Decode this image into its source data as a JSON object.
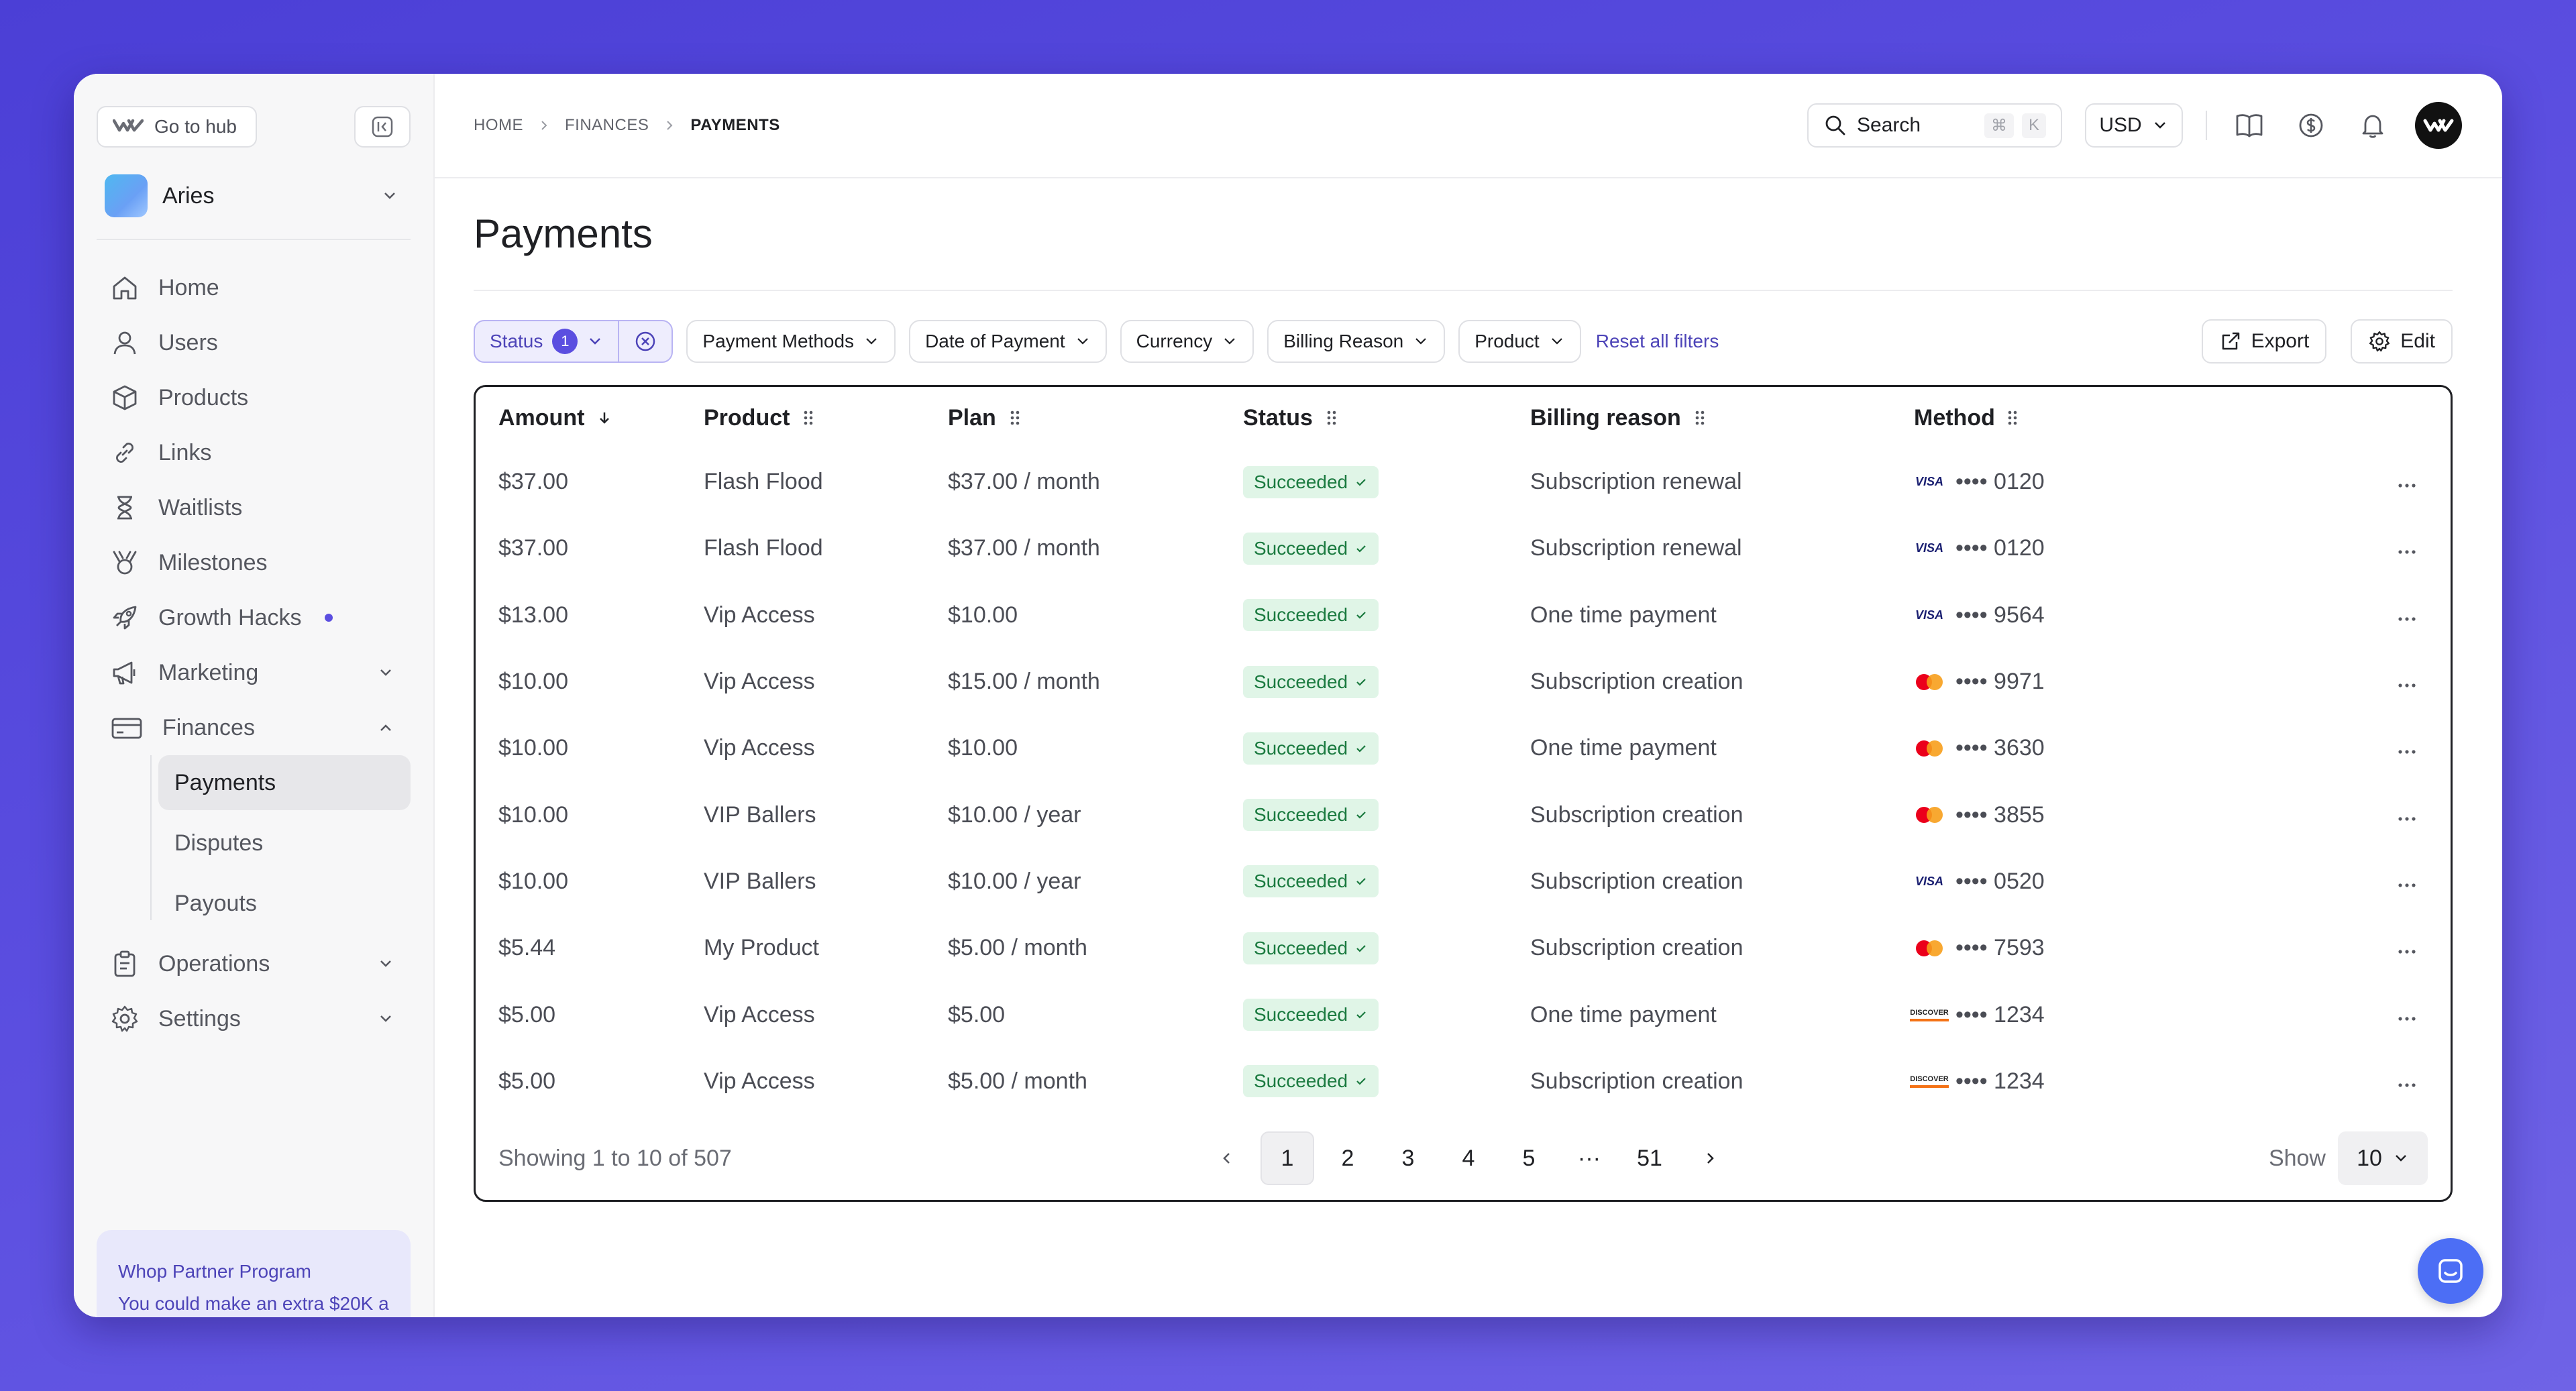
{
  "sidebar": {
    "hub_label": "Go to hub",
    "workspace": "Aries",
    "nav": [
      {
        "label": "Home",
        "icon": "home-icon"
      },
      {
        "label": "Users",
        "icon": "user-icon"
      },
      {
        "label": "Products",
        "icon": "box-icon"
      },
      {
        "label": "Links",
        "icon": "link-icon"
      },
      {
        "label": "Waitlists",
        "icon": "hourglass-icon"
      },
      {
        "label": "Milestones",
        "icon": "trophy-icon"
      },
      {
        "label": "Growth Hacks",
        "icon": "rocket-icon"
      },
      {
        "label": "Marketing",
        "icon": "megaphone-icon"
      },
      {
        "label": "Finances",
        "icon": "card-icon"
      }
    ],
    "finances_sub": [
      "Payments",
      "Disputes",
      "Payouts"
    ],
    "nav_bottom": [
      {
        "label": "Operations",
        "icon": "clipboard-icon"
      },
      {
        "label": "Settings",
        "icon": "gear-icon"
      }
    ],
    "partner": {
      "title": "Whop Partner Program",
      "text": "You could make an extra $20K a"
    }
  },
  "breadcrumb": [
    "HOME",
    "FINANCES",
    "PAYMENTS"
  ],
  "topbar": {
    "search_label": "Search",
    "kbd": [
      "⌘",
      "K"
    ],
    "currency": "USD"
  },
  "page": {
    "title": "Payments"
  },
  "filters": {
    "status_label": "Status",
    "status_count": "1",
    "chips": [
      "Payment Methods",
      "Date of Payment",
      "Currency",
      "Billing Reason",
      "Product"
    ],
    "reset": "Reset all filters",
    "export": "Export",
    "edit": "Edit"
  },
  "table": {
    "headers": [
      "Amount",
      "Product",
      "Plan",
      "Status",
      "Billing reason",
      "Method"
    ],
    "rows": [
      {
        "amount": "$37.00",
        "product": "Flash Flood",
        "plan": "$37.00 / month",
        "status": "Succeeded",
        "reason": "Subscription renewal",
        "brand": "visa",
        "last4": "•••• 0120"
      },
      {
        "amount": "$37.00",
        "product": "Flash Flood",
        "plan": "$37.00 / month",
        "status": "Succeeded",
        "reason": "Subscription renewal",
        "brand": "visa",
        "last4": "•••• 0120"
      },
      {
        "amount": "$13.00",
        "product": "Vip Access",
        "plan": "$10.00",
        "status": "Succeeded",
        "reason": "One time payment",
        "brand": "visa",
        "last4": "•••• 9564"
      },
      {
        "amount": "$10.00",
        "product": "Vip Access",
        "plan": "$15.00 / month",
        "status": "Succeeded",
        "reason": "Subscription creation",
        "brand": "mastercard",
        "last4": "•••• 9971"
      },
      {
        "amount": "$10.00",
        "product": "Vip Access",
        "plan": "$10.00",
        "status": "Succeeded",
        "reason": "One time payment",
        "brand": "mastercard",
        "last4": "•••• 3630"
      },
      {
        "amount": "$10.00",
        "product": "VIP Ballers",
        "plan": "$10.00 / year",
        "status": "Succeeded",
        "reason": "Subscription creation",
        "brand": "mastercard",
        "last4": "•••• 3855"
      },
      {
        "amount": "$10.00",
        "product": "VIP Ballers",
        "plan": "$10.00 / year",
        "status": "Succeeded",
        "reason": "Subscription creation",
        "brand": "visa",
        "last4": "•••• 0520"
      },
      {
        "amount": "$5.44",
        "product": "My Product",
        "plan": "$5.00 / month",
        "status": "Succeeded",
        "reason": "Subscription creation",
        "brand": "mastercard",
        "last4": "•••• 7593"
      },
      {
        "amount": "$5.00",
        "product": "Vip Access",
        "plan": "$5.00",
        "status": "Succeeded",
        "reason": "One time payment",
        "brand": "discover",
        "last4": "•••• 1234"
      },
      {
        "amount": "$5.00",
        "product": "Vip Access",
        "plan": "$5.00 / month",
        "status": "Succeeded",
        "reason": "Subscription creation",
        "brand": "discover",
        "last4": "•••• 1234"
      }
    ],
    "footer": {
      "showing": "Showing 1 to 10 of 507",
      "pages": [
        "1",
        "2",
        "3",
        "4",
        "5",
        "···",
        "51"
      ],
      "current_page": "1",
      "show_label": "Show",
      "page_size": "10"
    }
  },
  "colors": {
    "accent": "#5b4ee0",
    "success_bg": "#e0f5e7",
    "success_text": "#1a7a3f"
  }
}
